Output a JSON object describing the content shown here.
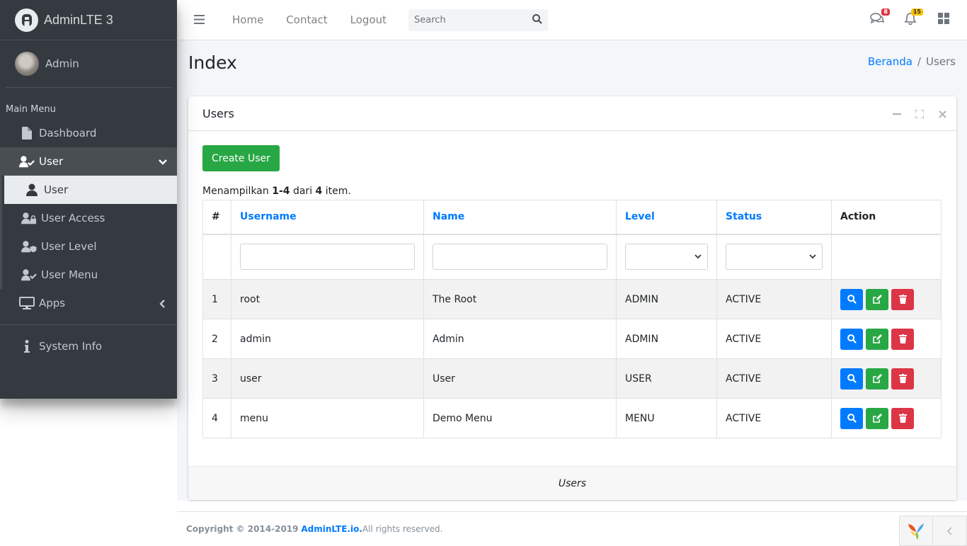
{
  "brand": {
    "name": "AdminLTE 3"
  },
  "user_panel": {
    "name": "Admin"
  },
  "sidebar": {
    "header": "Main Menu",
    "items": [
      {
        "label": "Dashboard",
        "icon": "file-icon"
      },
      {
        "label": "User",
        "icon": "user-check-icon"
      },
      {
        "label": "User",
        "icon": "user-icon"
      },
      {
        "label": "User Access",
        "icon": "user-lock-icon"
      },
      {
        "label": "User Level",
        "icon": "user-shield-icon"
      },
      {
        "label": "User Menu",
        "icon": "user-check-icon"
      },
      {
        "label": "Apps",
        "icon": "desktop-icon"
      },
      {
        "label": "System Info",
        "icon": "info-icon"
      }
    ]
  },
  "topbar": {
    "links": [
      "Home",
      "Contact",
      "Logout"
    ],
    "search_placeholder": "Search",
    "messages_badge": "8",
    "notifications_badge": "15"
  },
  "page": {
    "title": "Index",
    "breadcrumb": {
      "home": "Beranda",
      "current": "Users"
    }
  },
  "card": {
    "title": "Users",
    "create_button": "Create User",
    "summary": {
      "prefix": "Menampilkan ",
      "range": "1-4",
      "mid": " dari ",
      "total": "4",
      "suffix": " item."
    },
    "columns": [
      "#",
      "Username",
      "Name",
      "Level",
      "Status",
      "Action"
    ],
    "rows": [
      {
        "num": "1",
        "username": "root",
        "name": "The Root",
        "level": "ADMIN",
        "status": "ACTIVE"
      },
      {
        "num": "2",
        "username": "admin",
        "name": "Admin",
        "level": "ADMIN",
        "status": "ACTIVE"
      },
      {
        "num": "3",
        "username": "user",
        "name": "User",
        "level": "USER",
        "status": "ACTIVE"
      },
      {
        "num": "4",
        "username": "menu",
        "name": "Demo Menu",
        "level": "MENU",
        "status": "ACTIVE"
      }
    ],
    "footer": "Users"
  },
  "footer": {
    "copyright": "Copyright © 2014-2019 ",
    "brand_link": "AdminLTE.io.",
    "rights": " All rights reserved."
  },
  "colors": {
    "sidebar_bg": "#343a40",
    "primary": "#007bff",
    "success": "#28a745",
    "danger": "#dc3545",
    "warning": "#ffc107"
  }
}
